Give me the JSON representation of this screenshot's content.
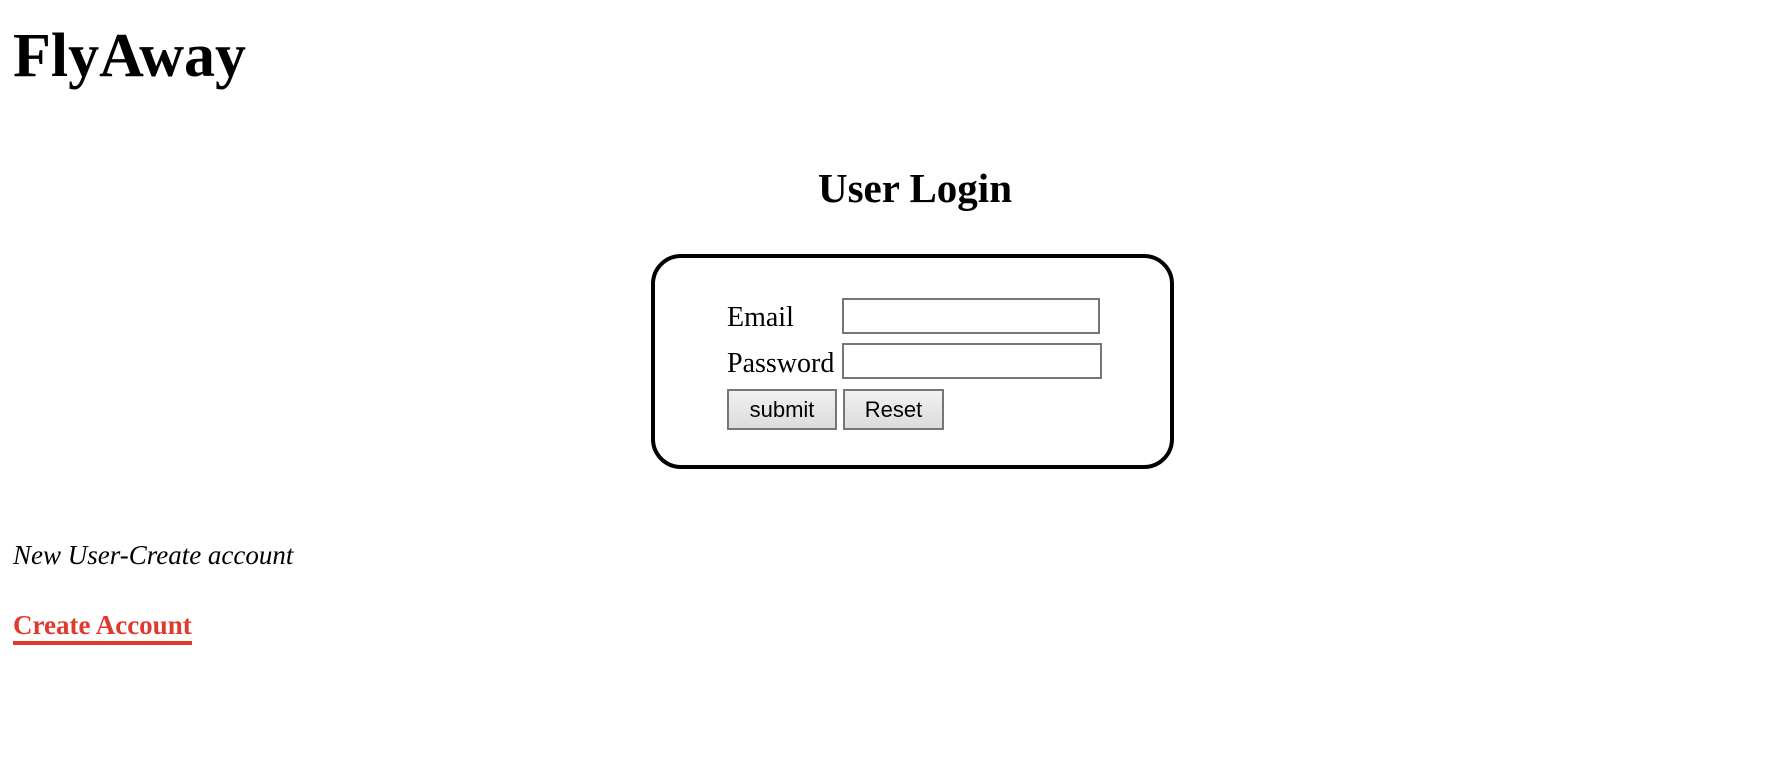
{
  "app": {
    "title": "FlyAway"
  },
  "login": {
    "heading": "User Login",
    "email_label": "Email",
    "email_value": "",
    "password_label": "Password",
    "password_value": "",
    "submit_label": "submit",
    "reset_label": "Reset"
  },
  "signup": {
    "prompt": "New User-Create account",
    "link_label": "Create Account"
  },
  "colors": {
    "link": "#e03a2c",
    "text": "#000000",
    "background": "#ffffff"
  }
}
